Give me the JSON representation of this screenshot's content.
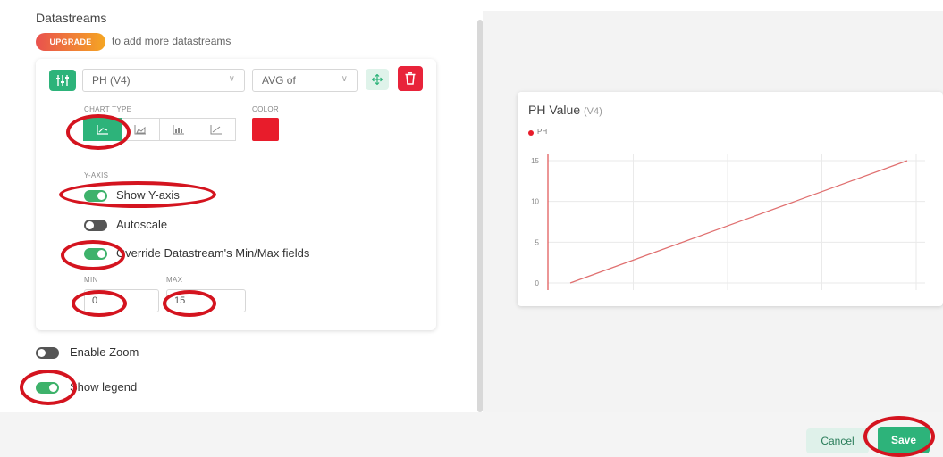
{
  "datastreams": {
    "title": "Datastreams",
    "upgrade_label": "UPGRADE",
    "upgrade_text": "to add more datastreams"
  },
  "datastream_row": {
    "selected": "PH (V4)",
    "aggregation": "AVG of",
    "chevron": "∨"
  },
  "chart_type": {
    "label": "CHART TYPE",
    "options": [
      "line",
      "area",
      "bar",
      "step"
    ]
  },
  "color": {
    "label": "COLOR",
    "value": "#e81c2b"
  },
  "y_axis": {
    "label": "Y-AXIS",
    "show_y_axis": {
      "label": "Show Y-axis",
      "state": true
    },
    "autoscale": {
      "label": "Autoscale",
      "state": false
    },
    "override": {
      "label": "Override Datastream's Min/Max fields",
      "state": true
    },
    "min": {
      "label": "MIN",
      "value": "0"
    },
    "max": {
      "label": "MAX",
      "value": "15"
    }
  },
  "enable_zoom": {
    "label": "Enable Zoom",
    "state": false
  },
  "show_legend": {
    "label": "Show legend",
    "state": true
  },
  "chart_preview": {
    "title": "PH Value",
    "pin": "(V4)",
    "legend": "PH"
  },
  "chart_data": {
    "type": "line",
    "title": "PH Value",
    "series": [
      {
        "name": "PH",
        "color": "#e81c2b",
        "x": [
          0,
          1
        ],
        "y": [
          0,
          15
        ]
      }
    ],
    "ylim": [
      0,
      15
    ],
    "yticks": [
      "0",
      "5",
      "10",
      "15"
    ],
    "grid": true,
    "legend_position": "top-left"
  },
  "footer": {
    "cancel_label": "Cancel",
    "save_label": "Save"
  },
  "colors": {
    "accent": "#2db37a",
    "danger": "#e81c2b",
    "annotation": "#d4141f"
  }
}
